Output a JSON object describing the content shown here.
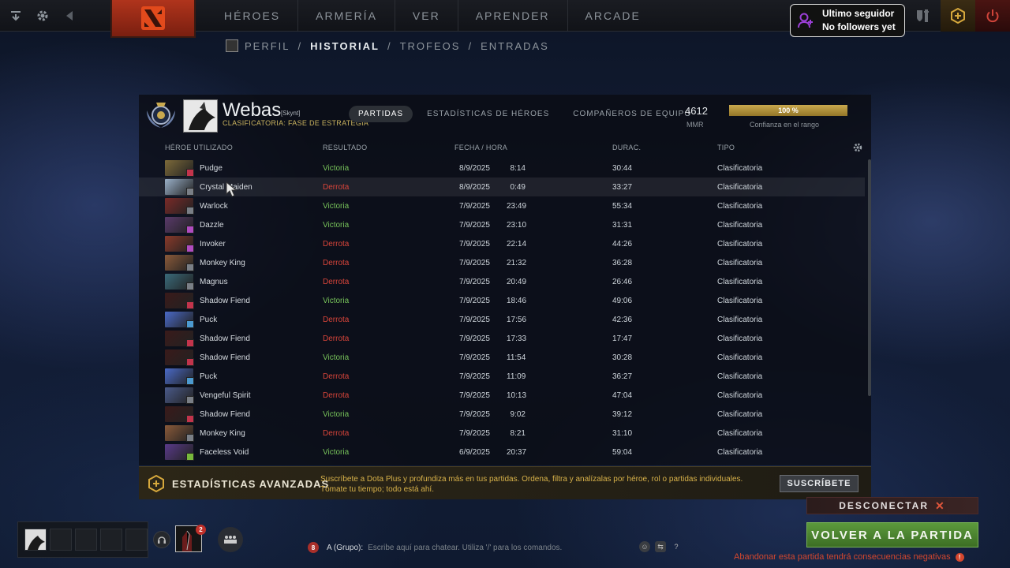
{
  "nav": {
    "items": [
      "HÉROES",
      "ARMERÍA",
      "VER",
      "APRENDER",
      "ARCADE"
    ]
  },
  "follower": {
    "line1": "Ultimo seguidor",
    "line2": "No followers yet"
  },
  "subnav": {
    "items": [
      "PERFIL",
      "HISTORIAL",
      "TROFEOS",
      "ENTRADAS"
    ],
    "active": "HISTORIAL",
    "separator": "/"
  },
  "profile": {
    "name": "Webas",
    "tag": "[Skynt]",
    "subtitle": "CLASIFICATORIA: FASE DE ESTRATEGIA",
    "tabs": [
      "PARTIDAS",
      "ESTADÍSTICAS DE HÉROES",
      "COMPAÑEROS DE EQUIPO"
    ],
    "active_tab": "PARTIDAS",
    "mmr": "4612",
    "mmr_label": "MMR",
    "confidence_text": "100 %",
    "confidence_value": 1.0,
    "confidence_label": "Confianza en el rango"
  },
  "table": {
    "headers": {
      "hero": "HÉROE UTILIZADO",
      "result": "RESULTADO",
      "date": "FECHA / HORA",
      "duration": "DURAC.",
      "type": "TIPO"
    },
    "rows": [
      {
        "hero": "Pudge",
        "result": "Victoria",
        "date": "8/9/2025",
        "time": "8:14",
        "duration": "30:44",
        "type": "Clasificatoria",
        "color": "#7d6a3a",
        "role_color": "#c2344c"
      },
      {
        "hero": "Crystal Maiden",
        "result": "Derrota",
        "date": "8/9/2025",
        "time": "0:49",
        "duration": "33:27",
        "type": "Clasificatoria",
        "color": "#9ab0c8",
        "role_color": "#7a7f86"
      },
      {
        "hero": "Warlock",
        "result": "Victoria",
        "date": "7/9/2025",
        "time": "23:49",
        "duration": "55:34",
        "type": "Clasificatoria",
        "color": "#7a2a28",
        "role_color": "#7a7f86"
      },
      {
        "hero": "Dazzle",
        "result": "Victoria",
        "date": "7/9/2025",
        "time": "23:10",
        "duration": "31:31",
        "type": "Clasificatoria",
        "color": "#5a3a6a",
        "role_color": "#b04cc0"
      },
      {
        "hero": "Invoker",
        "result": "Derrota",
        "date": "7/9/2025",
        "time": "22:14",
        "duration": "44:26",
        "type": "Clasificatoria",
        "color": "#8a3a2a",
        "role_color": "#b04cc0"
      },
      {
        "hero": "Monkey King",
        "result": "Derrota",
        "date": "7/9/2025",
        "time": "21:32",
        "duration": "36:28",
        "type": "Clasificatoria",
        "color": "#8a5a3a",
        "role_color": "#7a7f86"
      },
      {
        "hero": "Magnus",
        "result": "Derrota",
        "date": "7/9/2025",
        "time": "20:49",
        "duration": "26:46",
        "type": "Clasificatoria",
        "color": "#3a6a7a",
        "role_color": "#7a7f86"
      },
      {
        "hero": "Shadow Fiend",
        "result": "Victoria",
        "date": "7/9/2025",
        "time": "18:46",
        "duration": "49:06",
        "type": "Clasificatoria",
        "color": "#3a1a1a",
        "role_color": "#c2344c"
      },
      {
        "hero": "Puck",
        "result": "Derrota",
        "date": "7/9/2025",
        "time": "17:56",
        "duration": "42:36",
        "type": "Clasificatoria",
        "color": "#4a6ac8",
        "role_color": "#4c9ad0"
      },
      {
        "hero": "Shadow Fiend",
        "result": "Derrota",
        "date": "7/9/2025",
        "time": "17:33",
        "duration": "17:47",
        "type": "Clasificatoria",
        "color": "#3a1a1a",
        "role_color": "#c2344c"
      },
      {
        "hero": "Shadow Fiend",
        "result": "Victoria",
        "date": "7/9/2025",
        "time": "11:54",
        "duration": "30:28",
        "type": "Clasificatoria",
        "color": "#3a1a1a",
        "role_color": "#c2344c"
      },
      {
        "hero": "Puck",
        "result": "Derrota",
        "date": "7/9/2025",
        "time": "11:09",
        "duration": "36:27",
        "type": "Clasificatoria",
        "color": "#4a6ac8",
        "role_color": "#4c9ad0"
      },
      {
        "hero": "Vengeful Spirit",
        "result": "Derrota",
        "date": "7/9/2025",
        "time": "10:13",
        "duration": "47:04",
        "type": "Clasificatoria",
        "color": "#4a5a8a",
        "role_color": "#7a7f86"
      },
      {
        "hero": "Shadow Fiend",
        "result": "Victoria",
        "date": "7/9/2025",
        "time": "9:02",
        "duration": "39:12",
        "type": "Clasificatoria",
        "color": "#3a1a1a",
        "role_color": "#c2344c"
      },
      {
        "hero": "Monkey King",
        "result": "Derrota",
        "date": "7/9/2025",
        "time": "8:21",
        "duration": "31:10",
        "type": "Clasificatoria",
        "color": "#8a5a3a",
        "role_color": "#7a7f86"
      },
      {
        "hero": "Faceless Void",
        "result": "Victoria",
        "date": "6/9/2025",
        "time": "20:37",
        "duration": "59:04",
        "type": "Clasificatoria",
        "color": "#5a3a8a",
        "role_color": "#78b83c"
      }
    ]
  },
  "banner": {
    "title": "ESTADÍSTICAS AVANZADAS",
    "text": "Suscríbete a Dota Plus y profundiza más en tus partidas. Ordena, filtra y analízalas por héroe, rol o partidas individuales. Tómate tu tiempo; todo está ahí.",
    "button": "SUSCRÍBETE"
  },
  "bottom": {
    "hero_badge": "2",
    "chat_count": "8",
    "chat_channel": "A (Grupo):",
    "chat_placeholder": "Escribe aquí para chatear. Utiliza '/' para los comandos.",
    "disconnect": "DESCONECTAR",
    "return": "VOLVER A LA PARTIDA",
    "warning": "Abandonar esta partida tendrá consecuencias negativas"
  },
  "colors": {
    "win": "#77c35a",
    "loss": "#d9453a",
    "gold": "#c9a94e",
    "accent_green": "#5c9a3c"
  }
}
